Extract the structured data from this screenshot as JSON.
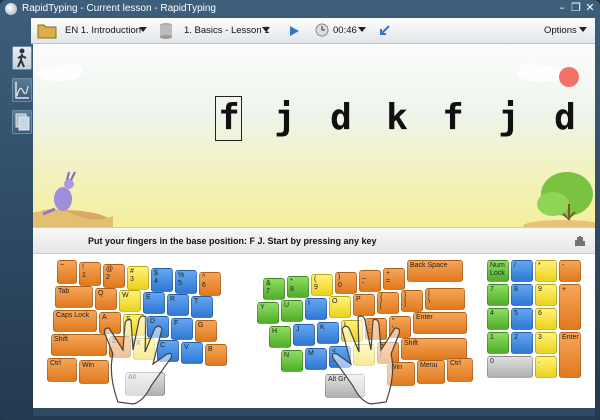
{
  "window": {
    "title": "RapidTyping - Current lesson - RapidTyping"
  },
  "toolbar": {
    "course": "EN 1. Introduction",
    "lesson": "1. Basics - Lesson 1",
    "timer": "00:46",
    "options": "Options"
  },
  "lesson": {
    "letters": [
      "f",
      "j",
      "d",
      "k",
      "f",
      "j",
      "d"
    ],
    "current_index": 0
  },
  "hint": "Put your fingers in the base position:  F J.  Start by pressing any key",
  "keyboard": {
    "left": [
      [
        "~",
        "!\n1",
        "@\n2",
        "#\n3",
        "$\n4",
        "%\n5",
        "^\n6"
      ],
      [
        "Tab",
        "Q",
        "W",
        "E",
        "R",
        "T"
      ],
      [
        "Caps Lock",
        "A",
        "S",
        "D",
        "F",
        "G"
      ],
      [
        "Shift",
        "Z",
        "X",
        "C",
        "V",
        "B"
      ],
      [
        "Ctrl",
        "Win",
        "Alt"
      ]
    ],
    "right": [
      [
        "&\n7",
        "*\n8",
        "(\n9",
        ")\n0",
        "_\n-",
        "+\n=",
        "Back Space"
      ],
      [
        "Y",
        "U",
        "I",
        "O",
        "P",
        "{\n[",
        "}\n]",
        "|\n\\"
      ],
      [
        "H",
        "J",
        "K",
        "L",
        ":\n;",
        "\"\n'",
        "Enter"
      ],
      [
        "N",
        "M",
        "<\n,",
        ">\n.",
        "?\n/",
        "Shift"
      ],
      [
        "Alt Gr",
        "Win",
        "Menu",
        "Ctrl"
      ]
    ],
    "numpad": [
      [
        "Num Lock",
        "/",
        "*",
        "-"
      ],
      [
        "7",
        "8",
        "9",
        "+"
      ],
      [
        "4",
        "5",
        "6"
      ],
      [
        "1",
        "2",
        "3",
        "Enter"
      ],
      [
        "0",
        "."
      ]
    ]
  }
}
